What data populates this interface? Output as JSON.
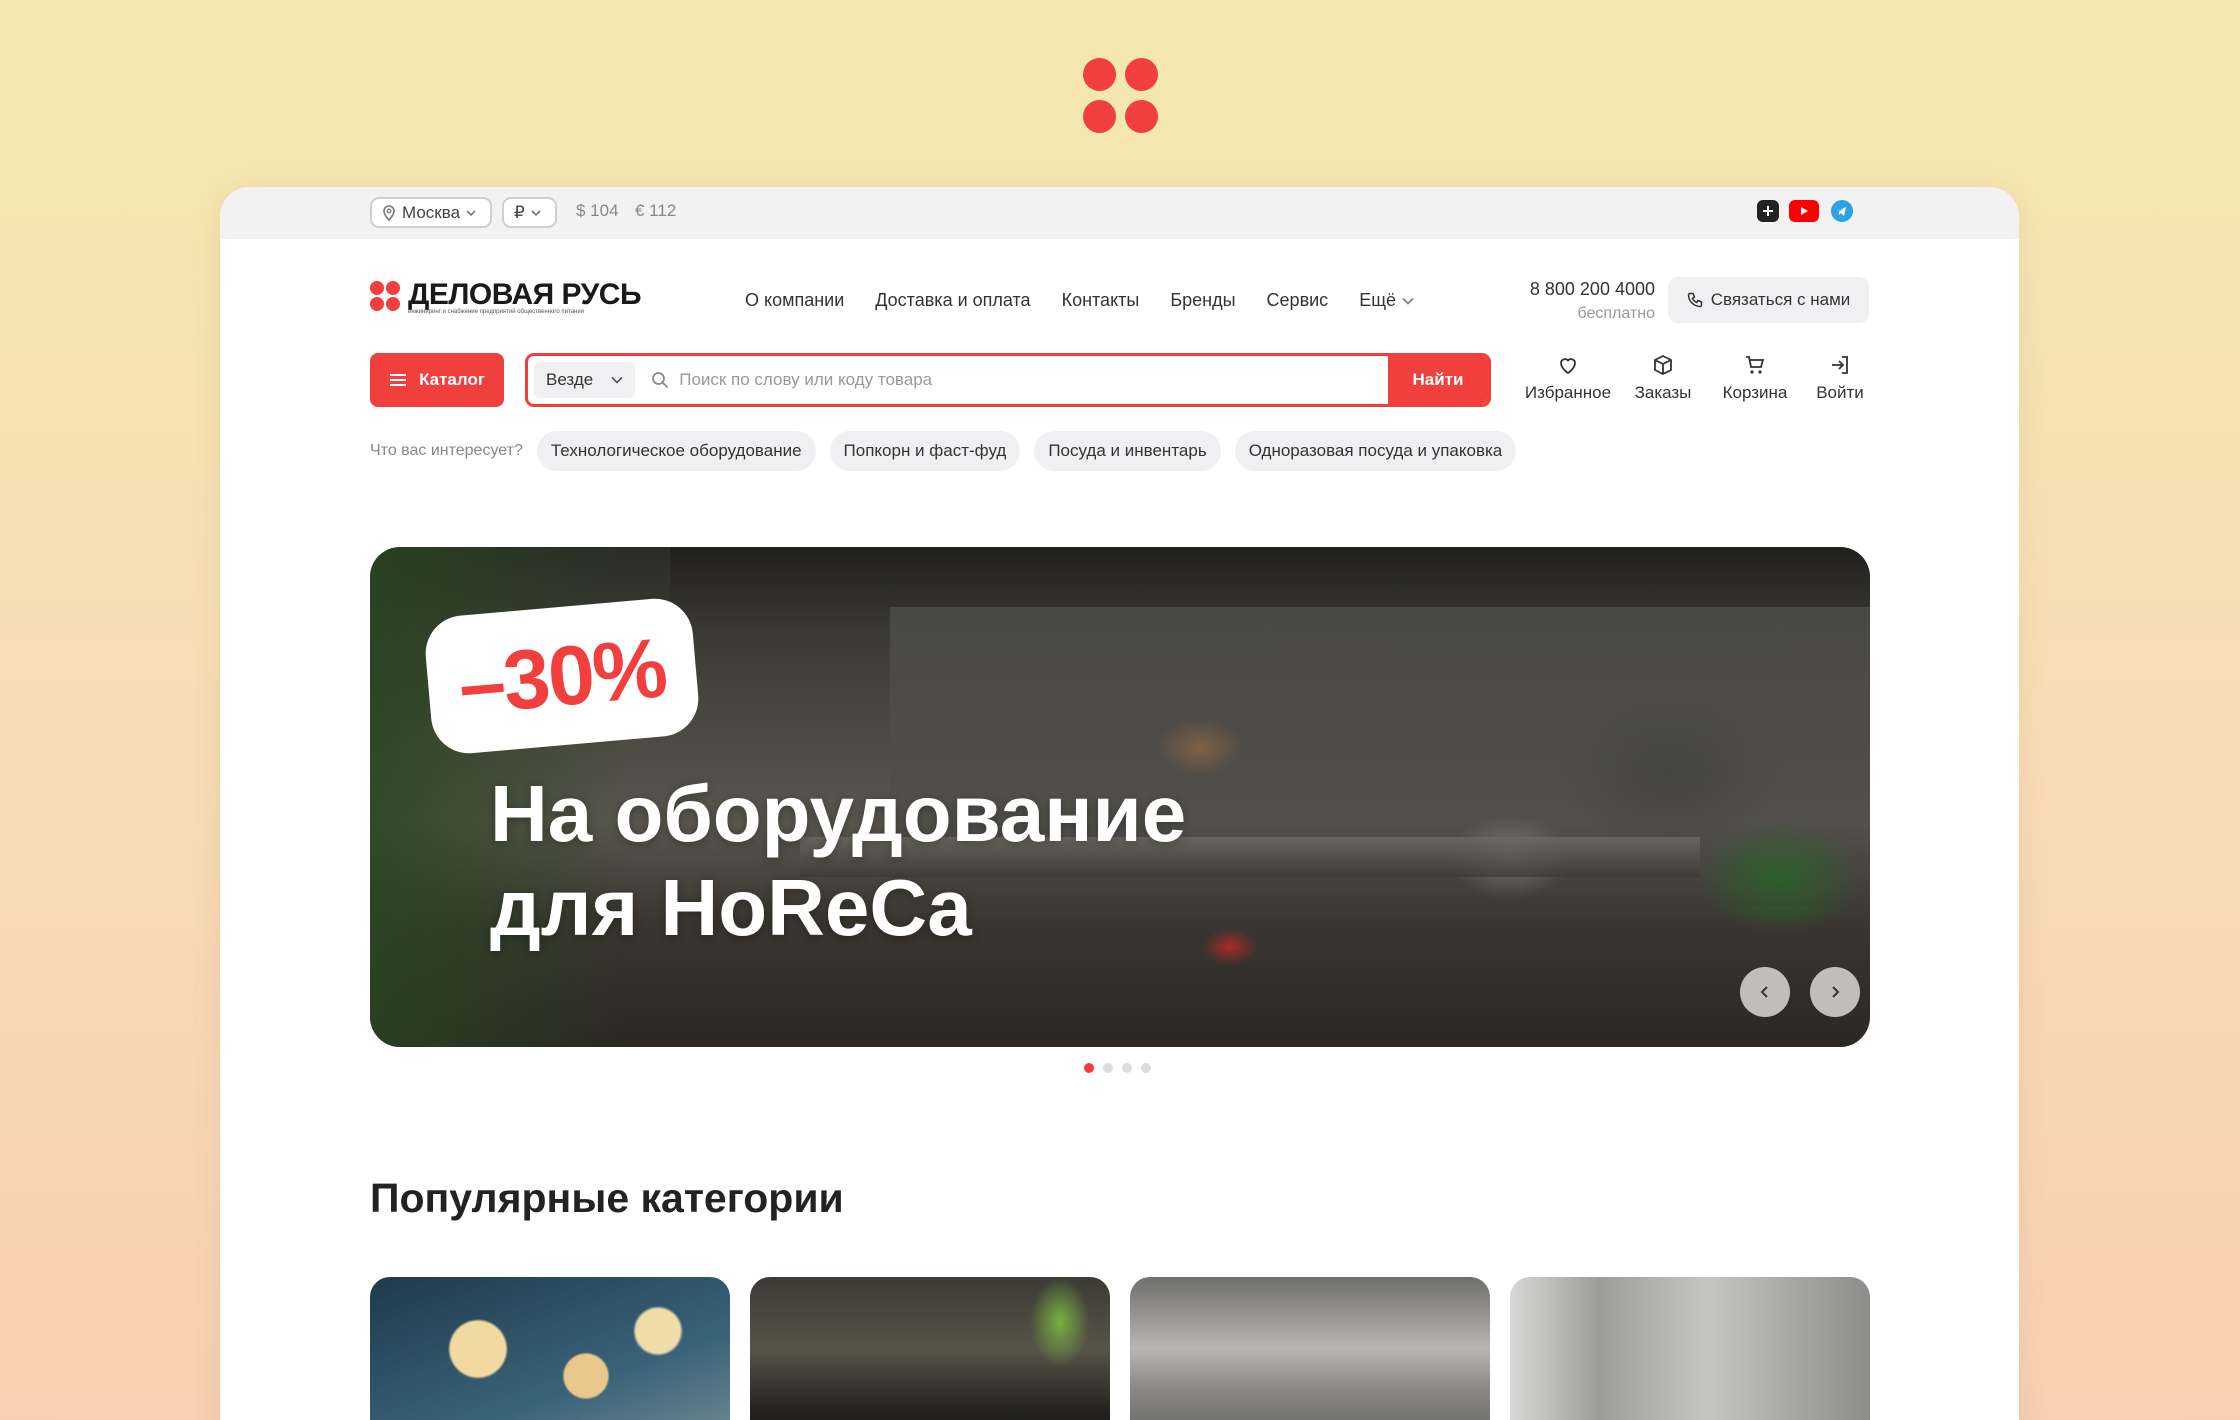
{
  "utility_bar": {
    "city": "Москва",
    "currency": "₽",
    "usd_rate": "$ 104",
    "eur_rate": "€ 112",
    "social_icons": [
      "vk-icon",
      "youtube-icon",
      "telegram-icon"
    ]
  },
  "brand": {
    "name": "ДЕЛОВАЯ РУСЬ",
    "tagline": "инжиниринг и снабжение предприятий общественного питания"
  },
  "nav": {
    "items": [
      "О компании",
      "Доставка и оплата",
      "Контакты",
      "Бренды",
      "Сервис"
    ],
    "more": "Ещё"
  },
  "contact": {
    "phone": "8 800 200 4000",
    "phone_note": "бесплатно",
    "button": "Связаться с нами"
  },
  "search": {
    "catalog_button": "Каталог",
    "scope": "Везде",
    "placeholder": "Поиск по слову или коду товара",
    "submit": "Найти"
  },
  "quick_links": {
    "favorites": "Избранное",
    "orders": "Заказы",
    "cart": "Корзина",
    "login": "Войти"
  },
  "interests": {
    "label": "Что вас интересует?",
    "chips": [
      "Технологическое оборудование",
      "Попкорн и фаст-фуд",
      "Посуда и инвентарь",
      "Одноразовая посуда и упаковка"
    ]
  },
  "hero": {
    "discount": "–30%",
    "title_line1": "На оборудование",
    "title_line2": "для HoReCa",
    "slides_total": 4,
    "active_slide": 1
  },
  "popular": {
    "title": "Популярные категории"
  },
  "colors": {
    "accent": "#f03f3d",
    "chip_bg": "#f0f0f2"
  }
}
